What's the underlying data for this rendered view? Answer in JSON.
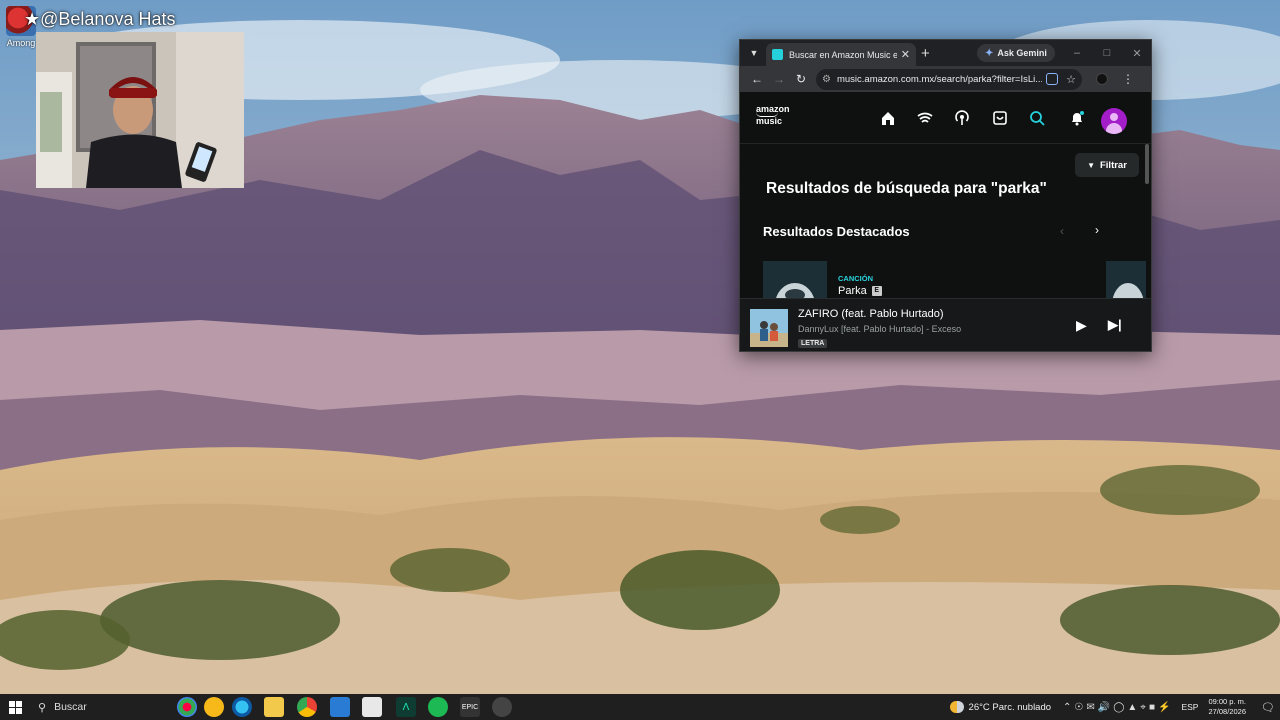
{
  "desktop": {
    "icon_label": "Among",
    "stream_title": "★@Belanova Hats"
  },
  "browser": {
    "tab_title": "Buscar en Amazon Music ex",
    "new_tab": "+",
    "gemini_label": "Ask Gemini",
    "url": "music.amazon.com.mx/search/parka?filter=IsLi...",
    "controls": {
      "minimize": "–",
      "maximize": "□",
      "close": "✕"
    }
  },
  "amazon_music": {
    "logo_line1": "amazon",
    "logo_line2": "music",
    "filter_label": "Filtrar",
    "results_title": "Resultados de búsqueda para \"parka\"",
    "section_title": "Resultados Destacados",
    "card": {
      "type": "CANCIÓN",
      "title": "Parka",
      "explicit": "E"
    },
    "now_playing": {
      "track": "ZAFIRO (feat. Pablo Hurtado)",
      "artist": "DannyLux [feat. Pablo Hurtado] - Exceso",
      "lyrics_badge": "LETRA"
    }
  },
  "taskbar": {
    "search_label": "Buscar",
    "weather": "26°C  Parc. nublado",
    "lang": "ESP",
    "time": "09:00 p. m.",
    "date": "27/08/2026"
  }
}
